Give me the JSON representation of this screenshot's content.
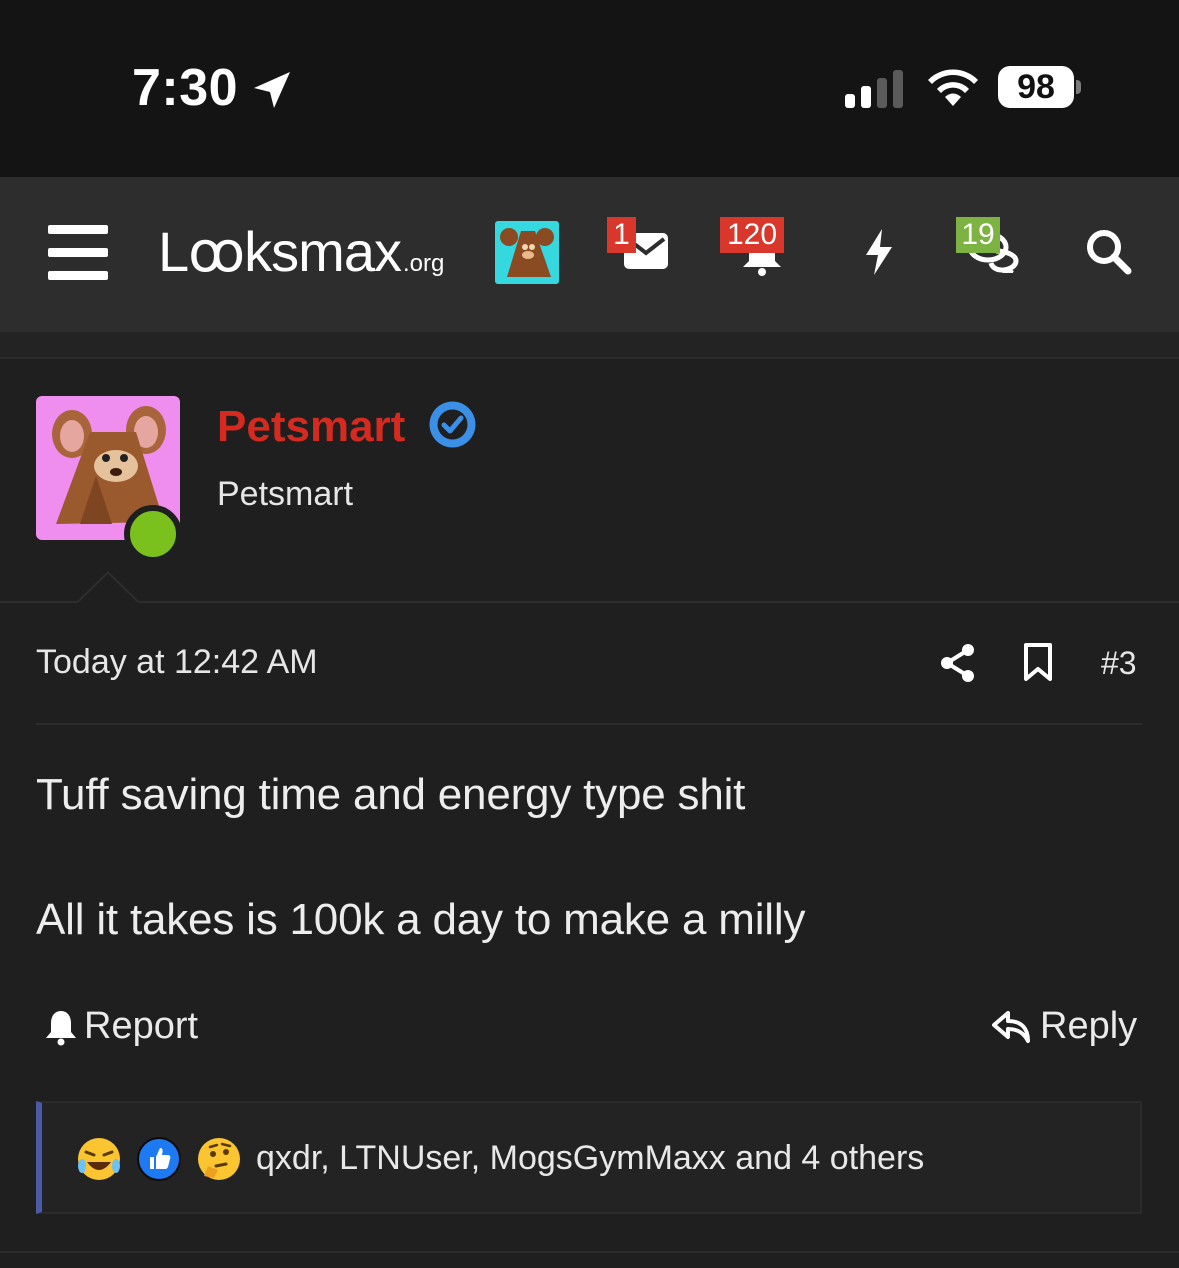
{
  "status_bar": {
    "time": "7:30",
    "battery": "98"
  },
  "nav": {
    "logo_main": "Lꝏksmax",
    "logo_tld": ".org",
    "badges": {
      "inbox": "1",
      "alerts": "120",
      "threads": "19"
    }
  },
  "post": {
    "username": "Petsmart",
    "user_title": "Petsmart",
    "date": "Today at 12:42 AM",
    "number": "#3",
    "lines": [
      "Tuff saving time and energy type shit",
      "All it takes is 100k a day to make a milly"
    ],
    "report_label": "Report",
    "reply_label": "Reply",
    "reactions_text": "qxdr, LTNUser, MogsGymMaxx and 4 others"
  },
  "colors": {
    "username": "#d42a1f",
    "verified": "#3b8fe6",
    "online": "#7bc11d",
    "badge_red": "#d9372b",
    "badge_green": "#7cb342",
    "reaction_border": "#4a5aa8"
  }
}
